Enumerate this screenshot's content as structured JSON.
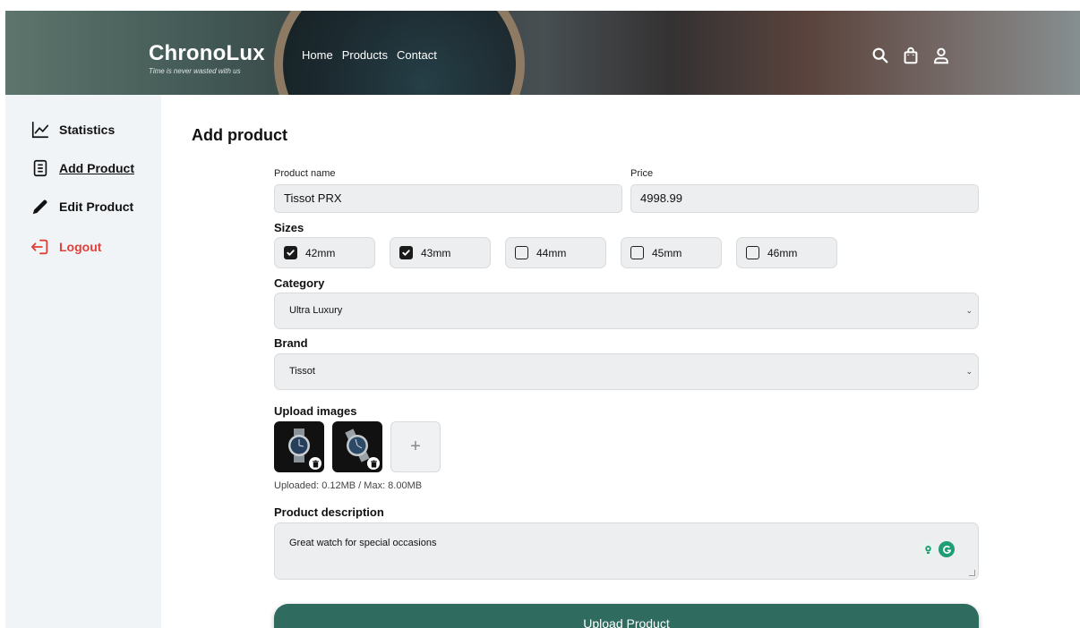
{
  "header": {
    "brand_name": "ChronoLux",
    "tagline": "Time is never wasted with us",
    "nav": [
      "Home",
      "Products",
      "Contact"
    ],
    "icons": [
      "search-icon",
      "shopping-bag-icon",
      "user-icon"
    ]
  },
  "sidebar": {
    "items": [
      {
        "label": "Statistics",
        "icon": "chart-line-icon"
      },
      {
        "label": "Add Product",
        "icon": "document-icon",
        "active": true
      },
      {
        "label": "Edit Product",
        "icon": "pencil-icon"
      },
      {
        "label": "Logout",
        "icon": "logout-icon",
        "color": "#e0403a"
      }
    ]
  },
  "main": {
    "title": "Add product",
    "product_name_label": "Product name",
    "product_name_value": "Tissot PRX",
    "price_label": "Price",
    "price_value": "4998.99",
    "sizes_label": "Sizes",
    "sizes": [
      {
        "label": "42mm",
        "checked": true
      },
      {
        "label": "43mm",
        "checked": true
      },
      {
        "label": "44mm",
        "checked": false
      },
      {
        "label": "45mm",
        "checked": false
      },
      {
        "label": "46mm",
        "checked": false
      }
    ],
    "category_label": "Category",
    "category_value": "Ultra Luxury",
    "brand_label": "Brand",
    "brand_value": "Tissot",
    "upload_images_label": "Upload images",
    "upload_info": "Uploaded: 0.12MB / Max: 8.00MB",
    "description_label": "Product description",
    "description_value": "Great watch for special occasions",
    "upload_button": "Upload Product"
  },
  "colors": {
    "accent": "#2f6b5f",
    "logout": "#e0403a",
    "sidebar_bg": "#f1f4f6",
    "input_bg": "#eceeef"
  }
}
